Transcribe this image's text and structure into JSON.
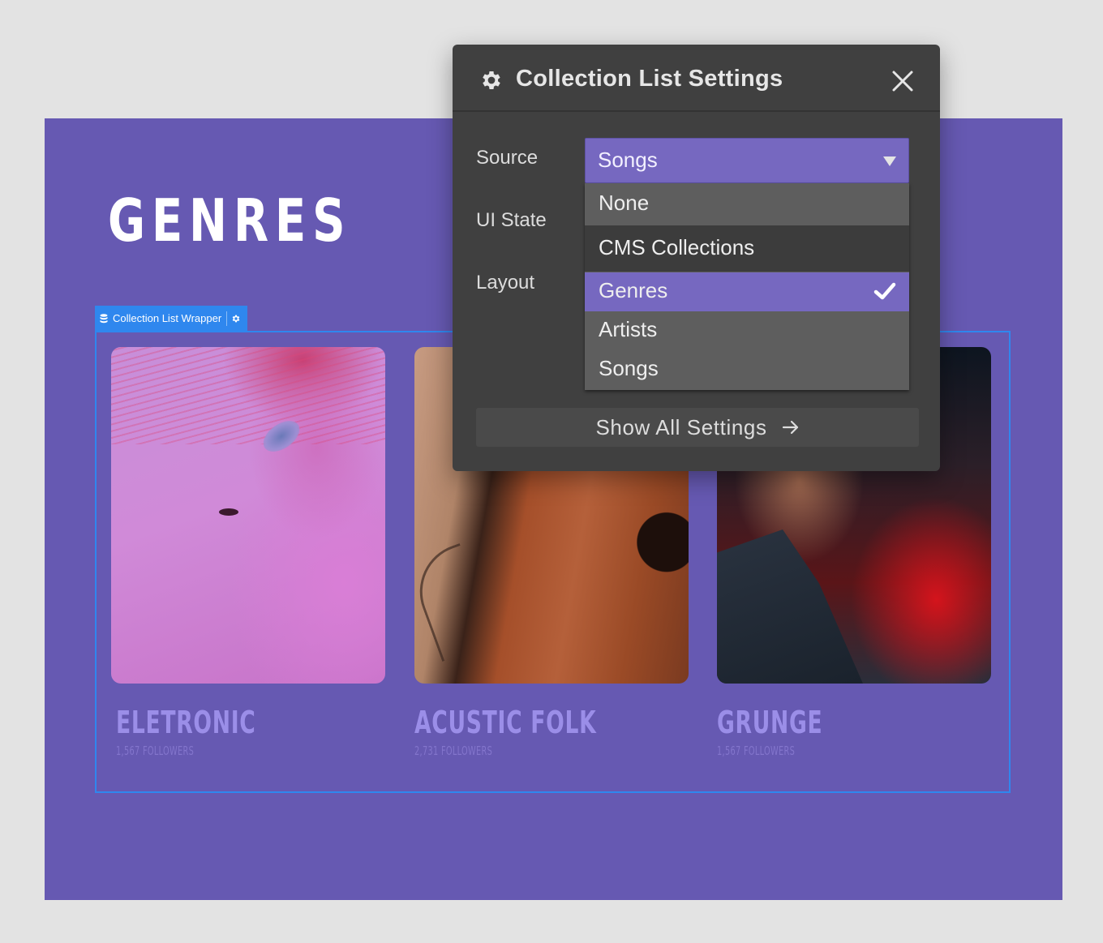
{
  "page": {
    "heading": "GENRES",
    "colors": {
      "page_background": "#e3e3e3",
      "canvas_purple": "#6659b2",
      "selection_blue": "#2f87ee",
      "modal_background": "#404040",
      "accent_purple": "#7668c0",
      "card_title": "#9b8ee8"
    }
  },
  "wrapper_badge": {
    "icon": "database-icon",
    "label": "Collection List Wrapper",
    "settings_icon": "gear-icon"
  },
  "cards": [
    {
      "title": "ELETRONIC",
      "followers": "1,567 FOLLOWERS",
      "image": "woman-with-pink-hair-photo"
    },
    {
      "title": "ACUSTIC FOLK",
      "followers": "2,731 FOLLOWERS",
      "image": "acoustic-guitar-photo"
    },
    {
      "title": "GRUNGE",
      "followers": "1,567 FOLLOWERS",
      "image": "singer-with-red-light-photo"
    }
  ],
  "modal": {
    "title": "Collection List Settings",
    "header_icon": "gear-icon",
    "close_icon": "close-icon",
    "fields": {
      "source_label": "Source",
      "ui_state_label": "UI State",
      "layout_label": "Layout"
    },
    "source_select": {
      "value": "Songs",
      "caret_icon": "caret-down-icon"
    },
    "dropdown": {
      "options": [
        {
          "label": "None",
          "type": "option"
        },
        {
          "label": "CMS Collections",
          "type": "group-header"
        },
        {
          "label": "Genres",
          "type": "option",
          "selected": true
        },
        {
          "label": "Artists",
          "type": "option"
        },
        {
          "label": "Songs",
          "type": "option"
        }
      ],
      "check_icon": "checkmark-icon"
    },
    "show_all_button": {
      "label": "Show All Settings",
      "icon": "arrow-right-icon"
    }
  }
}
